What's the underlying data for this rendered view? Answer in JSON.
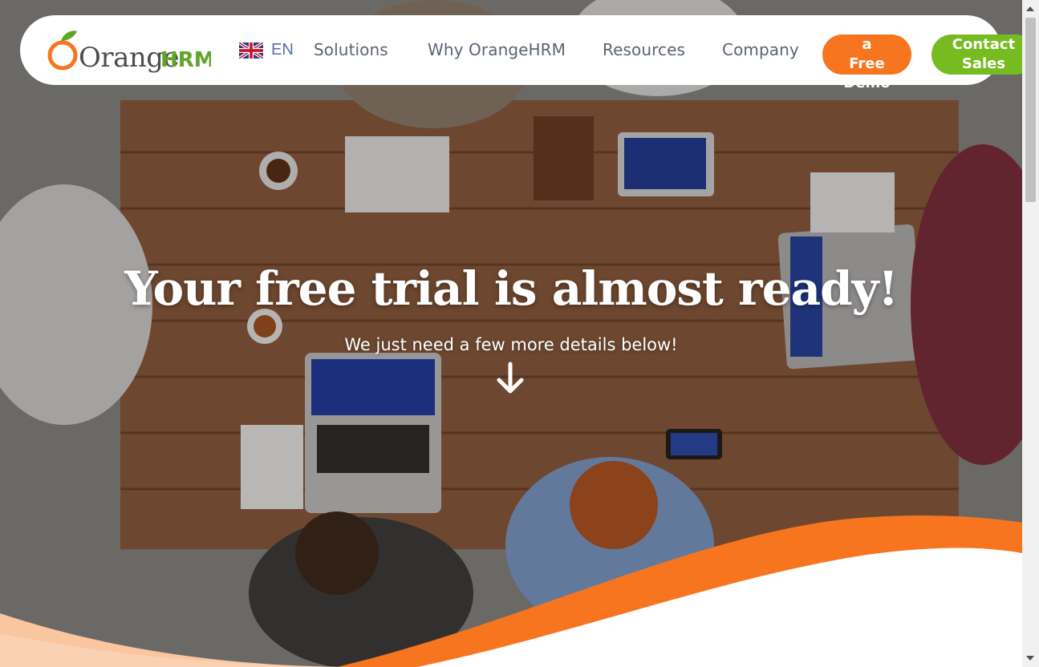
{
  "navbar": {
    "logo_text_orange": "Orange",
    "logo_text_hrm": "HRM",
    "language_code": "EN",
    "flag_icon": "uk-flag-icon",
    "menu": [
      "Solutions",
      "Why OrangeHRM",
      "Resources",
      "Company"
    ],
    "demo_button_label": "a Free Demo",
    "demo_button_visible_lines": [
      "a",
      "Free",
      "Demo"
    ],
    "contact_button_lines": [
      "Contact",
      "Sales"
    ]
  },
  "hero": {
    "title": "Your free trial is almost ready!",
    "subtitle": "We just need a few more details below!",
    "arrow_icon": "arrow-down-icon"
  },
  "colors": {
    "brand_orange": "#f7751e",
    "brand_green": "#76bc21",
    "nav_text": "#5b6475",
    "lang_text": "#5a6ea3",
    "wave_light": "#f9c6a0"
  }
}
